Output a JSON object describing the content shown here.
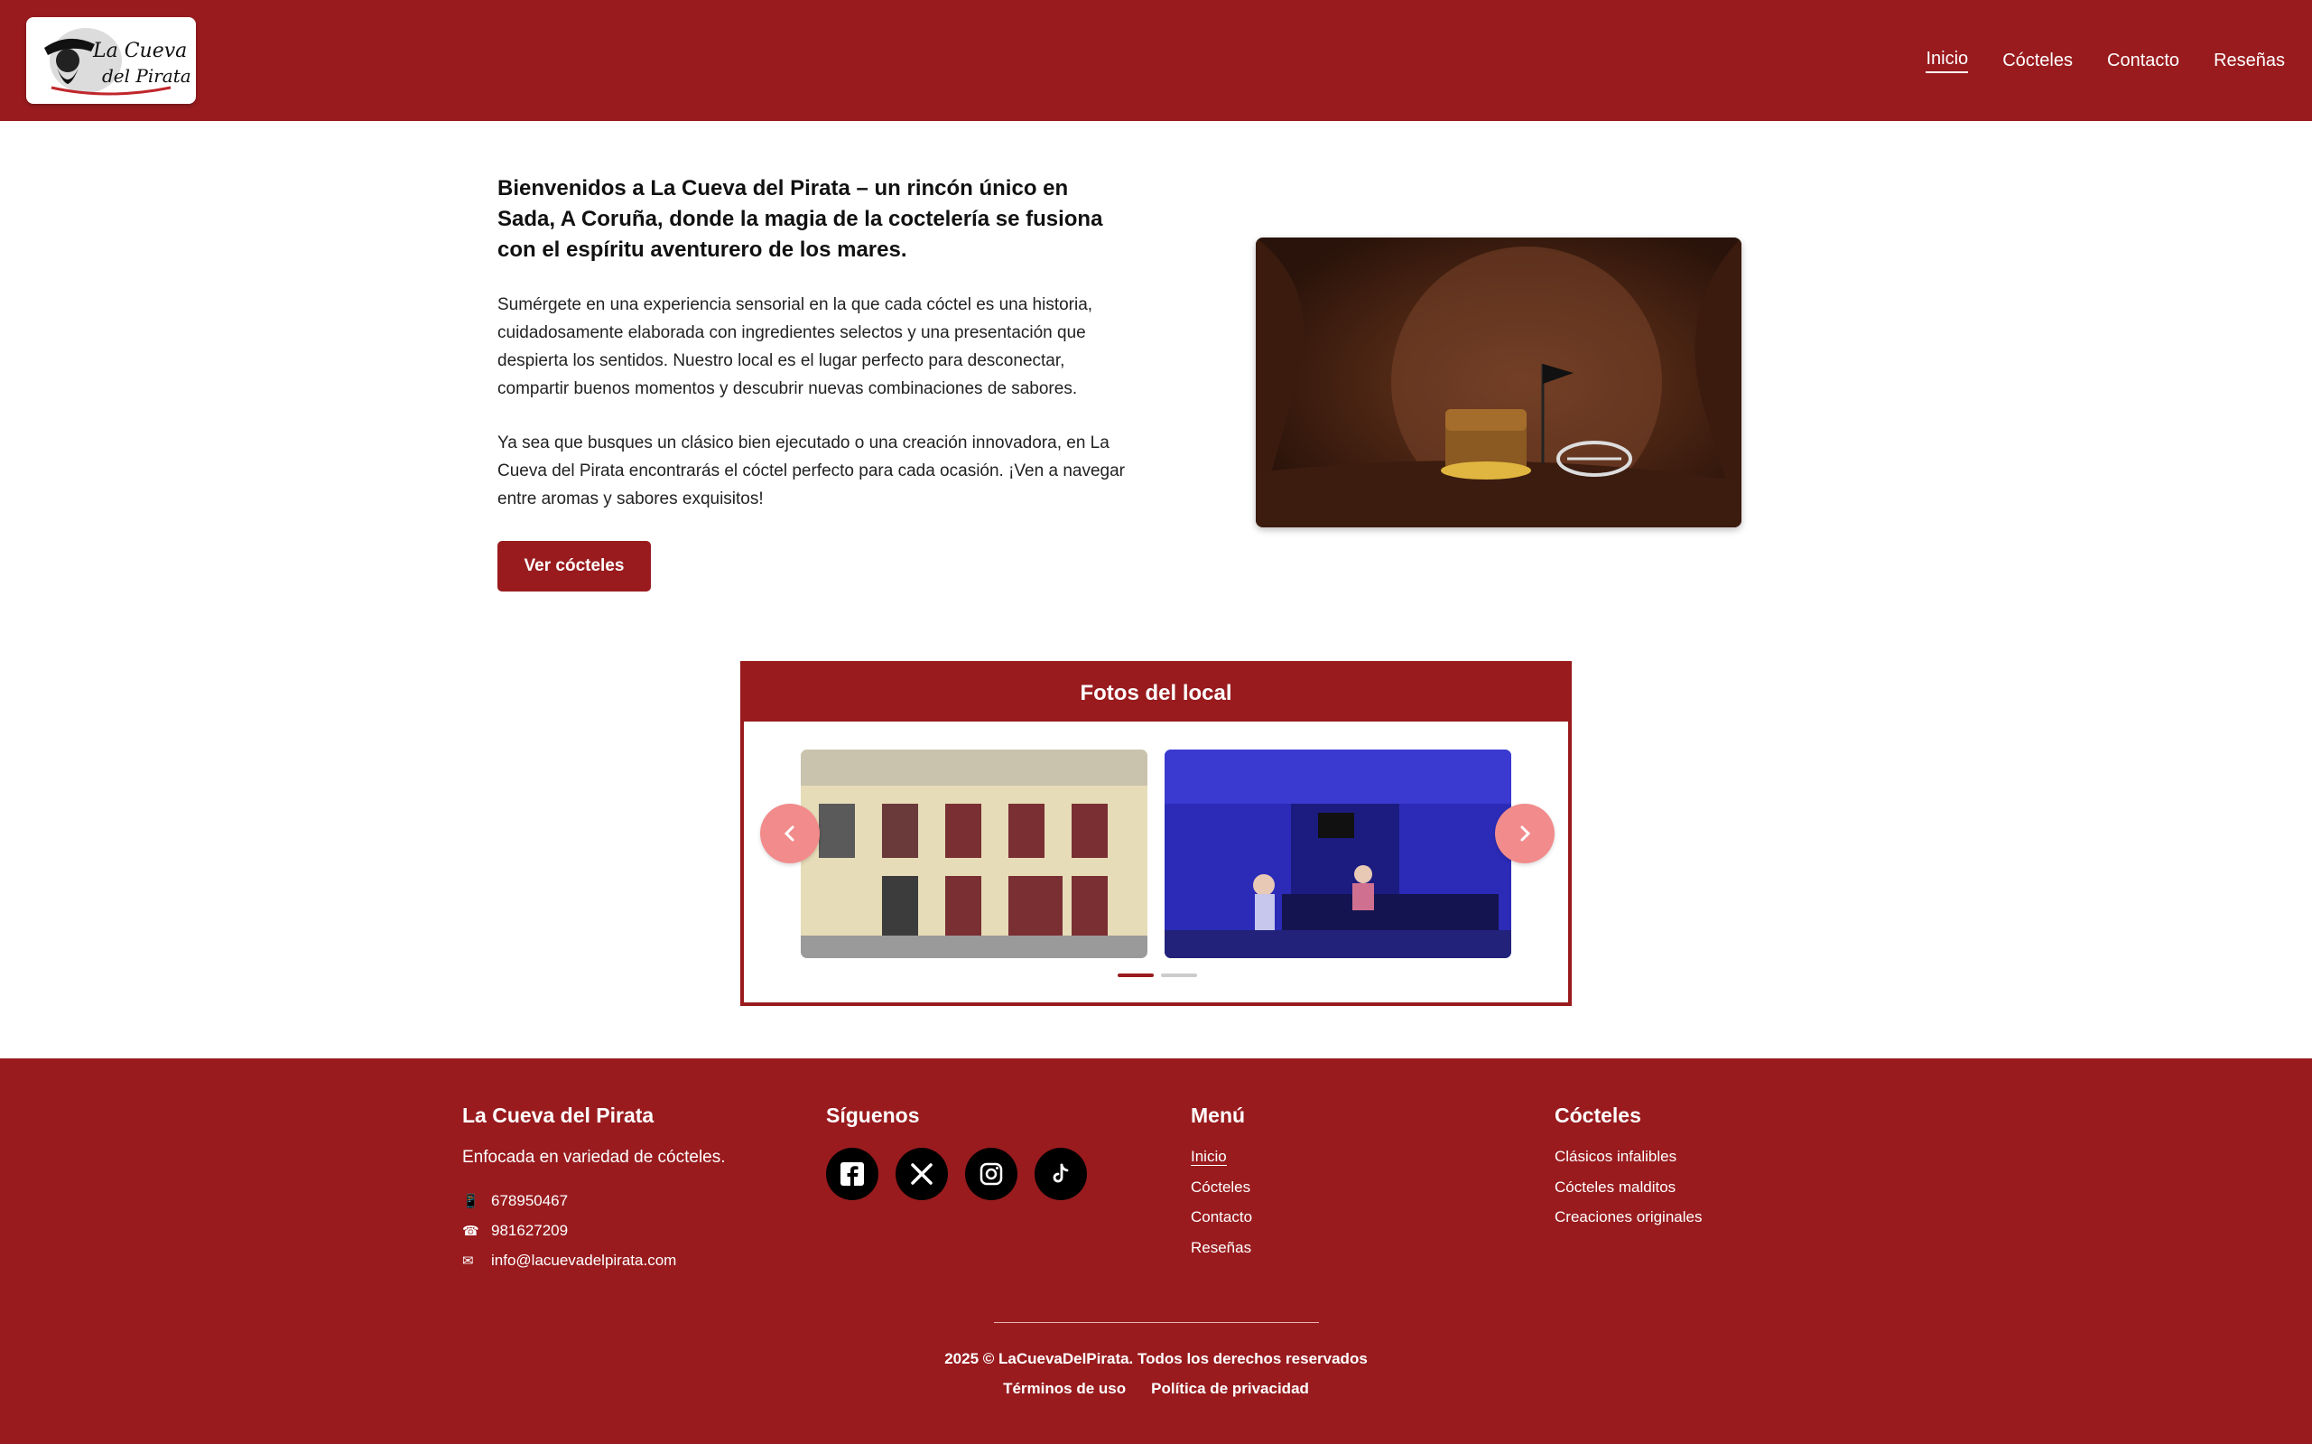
{
  "logo": {
    "line1": "La Cueva",
    "line2": "del Pirata"
  },
  "nav": {
    "items": [
      "Inicio",
      "Cócteles",
      "Contacto",
      "Reseñas"
    ],
    "active": "Inicio"
  },
  "hero": {
    "title": "Bienvenidos a La Cueva del Pirata – un rincón único en Sada, A Coruña, donde la magia de la coctelería se fusiona con el espíritu aventurero de los mares.",
    "p1": "Sumérgete en una experiencia sensorial en la que cada cóctel es una historia, cuidadosamente elaborada con ingredientes selectos y una presentación que despierta los sentidos. Nuestro local es el lugar perfecto para desconectar, compartir buenos momentos y descubrir nuevas combinaciones de sabores.",
    "p2": "Ya sea que busques un clásico bien ejecutado o una creación innovadora, en La Cueva del Pirata encontrarás el cóctel perfecto para cada ocasión. ¡Ven a navegar entre aromas y sabores exquisitos!",
    "button": "Ver cócteles"
  },
  "gallery": {
    "title": "Fotos del local",
    "prev_icon": "chevron-left-icon",
    "next_icon": "chevron-right-icon",
    "pages": 2,
    "current_page": 1
  },
  "footer": {
    "brand": {
      "title": "La Cueva del Pirata",
      "tagline": "Enfocada en variedad de cócteles.",
      "mobile": "678950467",
      "phone": "981627209",
      "email": "info@lacuevadelpirata.com"
    },
    "social": {
      "title": "Síguenos",
      "icons": [
        "facebook-icon",
        "x-icon",
        "instagram-icon",
        "tiktok-icon"
      ]
    },
    "menu": {
      "title": "Menú",
      "items": [
        "Inicio",
        "Cócteles",
        "Contacto",
        "Reseñas"
      ]
    },
    "cocteles": {
      "title": "Cócteles",
      "items": [
        "Clásicos infalibles",
        "Cócteles malditos",
        "Creaciones originales"
      ]
    },
    "copyright": "2025 © LaCuevaDelPirata. Todos los derechos reservados",
    "legal": [
      "Términos de uso",
      "Política de privacidad"
    ]
  },
  "colors": {
    "brand": "#991b1e",
    "arrow": "#f28b8b",
    "dot_inactive": "#cccccc"
  }
}
